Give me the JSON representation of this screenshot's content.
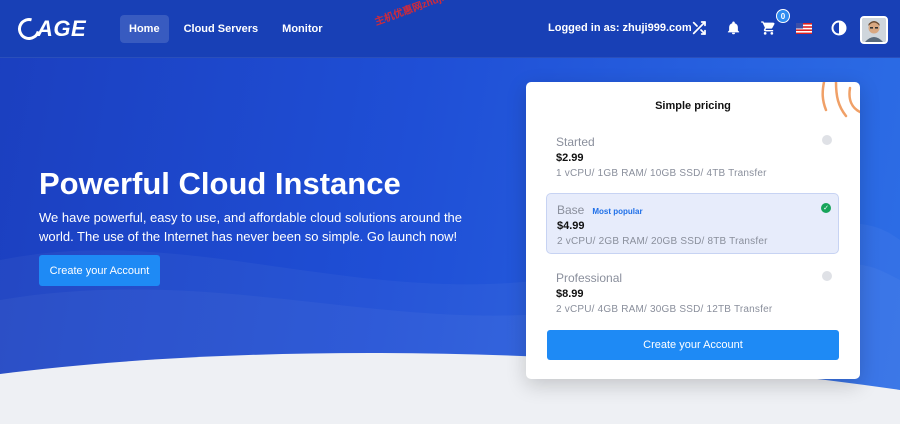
{
  "brand": {
    "logo_text": "AGE"
  },
  "nav": {
    "items": [
      {
        "label": "Home",
        "active": true
      },
      {
        "label": "Cloud Servers",
        "active": false
      },
      {
        "label": "Monitor",
        "active": false
      }
    ]
  },
  "watermark": "主机优惠网zhuji999.com",
  "header": {
    "logged_in_text": "Logged in as: zhuji999.com",
    "cart_count": "0",
    "icons": [
      "shuffle-icon",
      "bell-icon",
      "cart-icon",
      "us-flag-icon",
      "contrast-icon",
      "avatar"
    ]
  },
  "hero": {
    "title": "Powerful Cloud Instance",
    "subtitle": "We have powerful, easy to use, and affordable cloud solutions around the world. The use of the Internet has never been so simple. Go launch now!",
    "cta_label": "Create your Account"
  },
  "pricing": {
    "title": "Simple pricing",
    "plans": [
      {
        "name": "Started",
        "price": "$2.99",
        "spec": "1 vCPU/ 1GB RAM/ 10GB SSD/ 4TB Transfer",
        "tag": "",
        "selected": false
      },
      {
        "name": "Base",
        "price": "$4.99",
        "spec": "2 vCPU/ 2GB RAM/ 20GB SSD/ 8TB Transfer",
        "tag": "Most popular",
        "selected": true
      },
      {
        "name": "Professional",
        "price": "$8.99",
        "spec": "2 vCPU/ 4GB RAM/ 30GB SSD/ 12TB Transfer",
        "tag": "",
        "selected": false
      }
    ],
    "cta_label": "Create your Account"
  },
  "colors": {
    "accent": "#1e8af5",
    "hero_start": "#1b3fbf",
    "hero_end": "#2d6ee6",
    "selected_check": "#17a45a"
  }
}
